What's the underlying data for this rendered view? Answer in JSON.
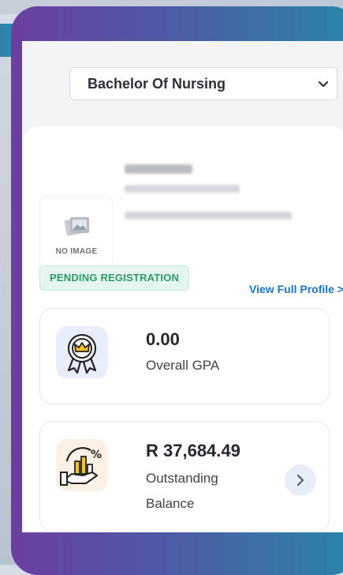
{
  "program_select": {
    "selected": "Bachelor Of Nursing"
  },
  "profile": {
    "avatar_caption": "NO IMAGE",
    "status_badge": "PENDING REGISTRATION",
    "view_full_profile": "View Full Profile >"
  },
  "gpa": {
    "value": "0.00",
    "label": "Overall GPA"
  },
  "balance": {
    "value": "R 37,684.49",
    "label_line1": "Outstanding",
    "label_line2": "Balance"
  },
  "icons": {
    "chevron": "chevron-down-icon",
    "avatar": "image-placeholder-icon",
    "gpa": "award-badge-icon",
    "balance": "finance-chart-icon",
    "arrow": "chevron-right-icon"
  },
  "colors": {
    "frame_gradient_start": "#6a3fa0",
    "frame_gradient_end": "#2a86a8",
    "badge_green": "#2e9a6a",
    "link_blue": "#1a73c8"
  }
}
